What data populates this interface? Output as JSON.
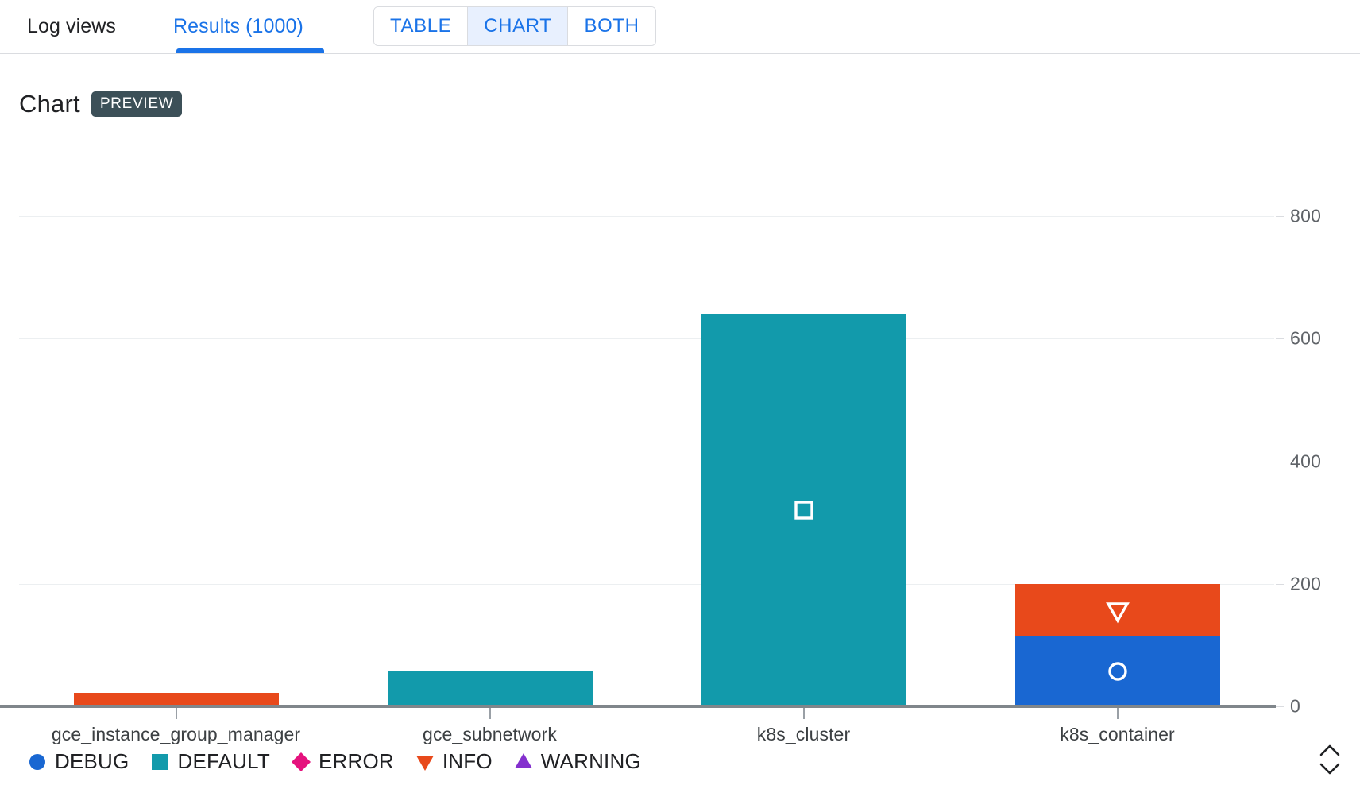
{
  "tabs": [
    {
      "id": "log-views",
      "label": "Log views",
      "active": false
    },
    {
      "id": "results",
      "label": "Results (1000)",
      "active": true
    }
  ],
  "view_toggle": {
    "options": [
      "TABLE",
      "CHART",
      "BOTH"
    ],
    "selected": "CHART",
    "table_label": "TABLE",
    "chart_label": "CHART",
    "both_label": "BOTH"
  },
  "heading": {
    "title": "Chart",
    "badge": "PREVIEW"
  },
  "expand_control": {
    "name": "expand-collapse-icon"
  },
  "colors": {
    "accent": "#1a73e8",
    "debug": "#1967d2",
    "default": "#129aab",
    "error": "#e5127d",
    "info": "#e8491b",
    "warning": "#8430ce",
    "axis": "#80868b",
    "grid": "#eceff1",
    "badge_bg": "#3c5058"
  },
  "chart_data": {
    "type": "bar",
    "stacked": true,
    "title": "Chart",
    "xlabel": "",
    "ylabel": "",
    "ylim": [
      0,
      880
    ],
    "yticks": [
      0,
      200,
      400,
      600,
      800
    ],
    "ytick_labels": [
      "0",
      "200",
      "400",
      "600",
      "800"
    ],
    "grid": true,
    "legend_position": "bottom-left",
    "categories": [
      "gce_instance_group_manager",
      "gce_subnetwork",
      "k8s_cluster",
      "k8s_container"
    ],
    "series": [
      {
        "name": "DEBUG",
        "color": "#1967d2",
        "marker": "circle",
        "values": [
          0,
          0,
          0,
          115
        ]
      },
      {
        "name": "DEFAULT",
        "color": "#129aab",
        "marker": "square",
        "values": [
          0,
          57,
          640,
          0
        ]
      },
      {
        "name": "ERROR",
        "color": "#e5127d",
        "marker": "diamond",
        "values": [
          0,
          0,
          0,
          0
        ]
      },
      {
        "name": "INFO",
        "color": "#e8491b",
        "marker": "triangle-down",
        "values": [
          22,
          0,
          0,
          85
        ]
      },
      {
        "name": "WARNING",
        "color": "#8430ce",
        "marker": "triangle-up",
        "values": [
          0,
          0,
          0,
          0
        ]
      }
    ]
  }
}
